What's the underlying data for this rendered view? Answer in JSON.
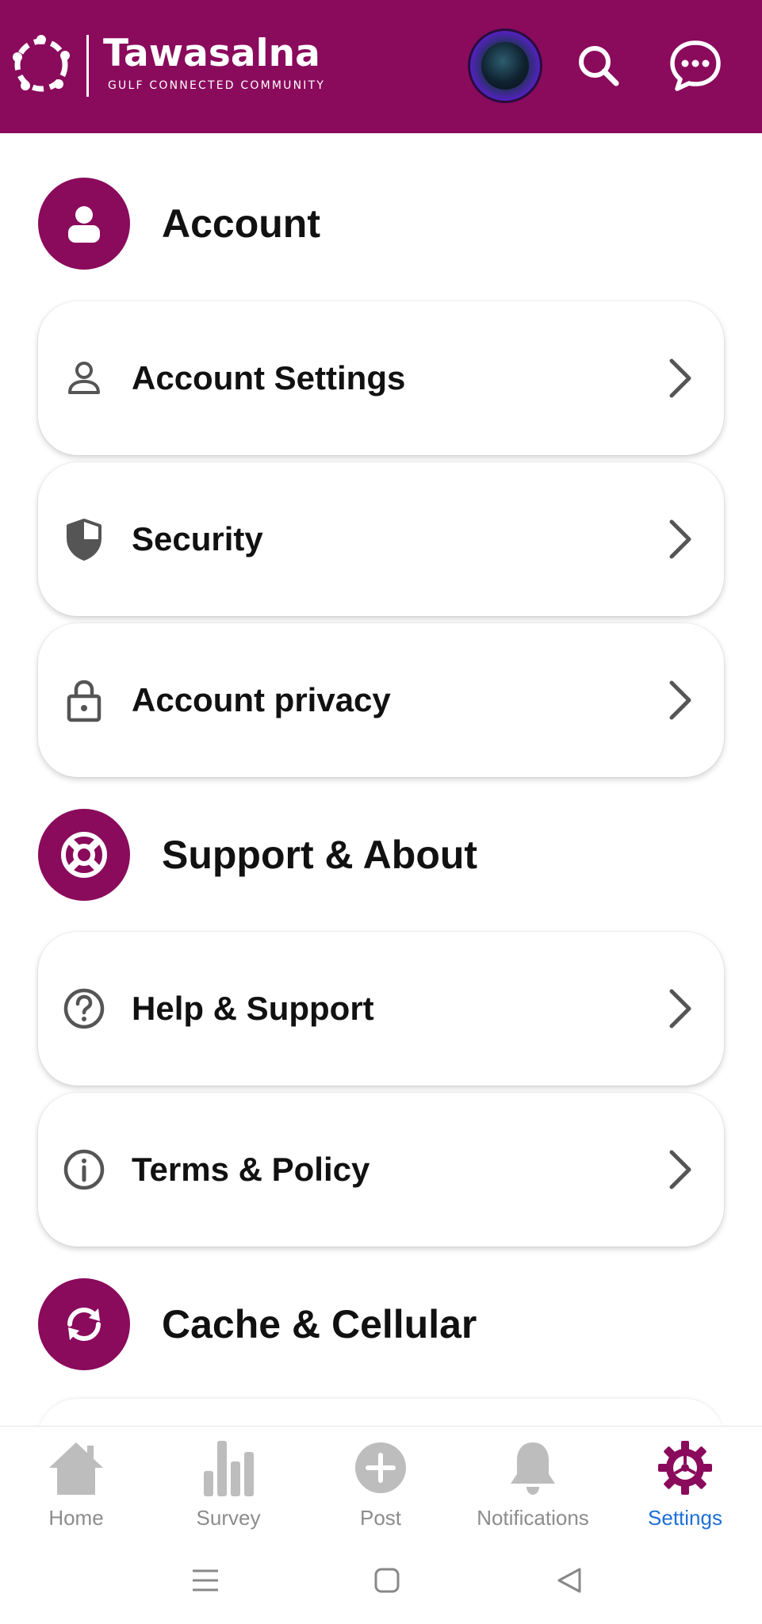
{
  "app": {
    "brand_title": "Tawasalna",
    "brand_subtitle": "GULF CONNECTED COMMUNITY"
  },
  "colors": {
    "brand": "#8a0a5c",
    "active_nav": "#1d6fd8",
    "inactive_nav": "#bdbdbd"
  },
  "header": {
    "avatar_icon": "profile-avatar",
    "search_icon": "search-icon",
    "chat_icon": "chat-bubble-icon"
  },
  "sections": {
    "account": {
      "title": "Account",
      "icon": "user-icon",
      "items": [
        {
          "label": "Account Settings",
          "icon": "person-outline-icon"
        },
        {
          "label": "Security",
          "icon": "shield-icon"
        },
        {
          "label": "Account privacy",
          "icon": "lock-icon"
        }
      ]
    },
    "support": {
      "title": "Support & About",
      "icon": "lifebuoy-icon",
      "items": [
        {
          "label": "Help & Support",
          "icon": "question-circle-icon"
        },
        {
          "label": "Terms & Policy",
          "icon": "info-circle-icon"
        }
      ]
    },
    "cache": {
      "title": "Cache & Cellular",
      "icon": "refresh-icon"
    }
  },
  "bottom_nav": {
    "items": [
      {
        "label": "Home",
        "icon": "home-icon"
      },
      {
        "label": "Survey",
        "icon": "bar-chart-icon"
      },
      {
        "label": "Post",
        "icon": "plus-circle-icon"
      },
      {
        "label": "Notifications",
        "icon": "bell-icon"
      },
      {
        "label": "Settings",
        "icon": "gear-icon",
        "active": true
      }
    ]
  },
  "system_bar": {
    "buttons": [
      "menu-icon",
      "home-square-icon",
      "back-triangle-icon"
    ]
  }
}
